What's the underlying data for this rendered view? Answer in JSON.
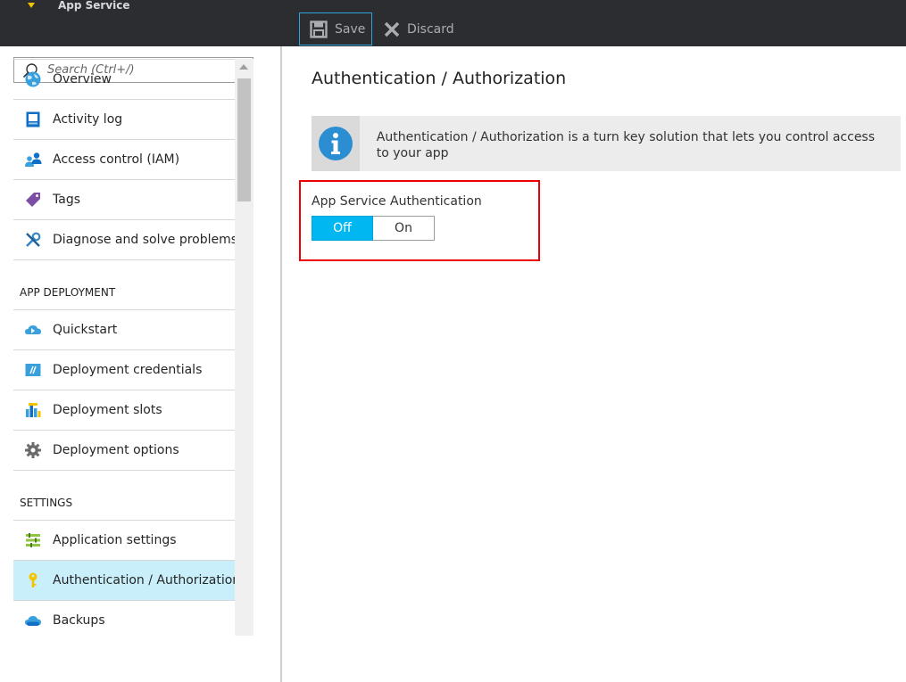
{
  "header": {
    "app_title": "App Service",
    "save_label": "Save",
    "discard_label": "Discard"
  },
  "search": {
    "placeholder": "Search (Ctrl+/)"
  },
  "sidebar": {
    "items": [
      {
        "label": "Overview",
        "icon": "globe-icon"
      },
      {
        "label": "Activity log",
        "icon": "activity-log-icon"
      },
      {
        "label": "Access control (IAM)",
        "icon": "people-icon"
      },
      {
        "label": "Tags",
        "icon": "tag-icon"
      },
      {
        "label": "Diagnose and solve problems",
        "icon": "wrench-icon"
      }
    ],
    "sections": [
      {
        "title": "APP DEPLOYMENT",
        "items": [
          {
            "label": "Quickstart",
            "icon": "cloud-icon"
          },
          {
            "label": "Deployment credentials",
            "icon": "credentials-icon"
          },
          {
            "label": "Deployment slots",
            "icon": "slots-icon"
          },
          {
            "label": "Deployment options",
            "icon": "gear-icon"
          }
        ]
      },
      {
        "title": "SETTINGS",
        "items": [
          {
            "label": "Application settings",
            "icon": "settings-list-icon"
          },
          {
            "label": "Authentication / Authorization",
            "icon": "key-icon",
            "active": true
          },
          {
            "label": "Backups",
            "icon": "backup-cloud-icon"
          }
        ]
      }
    ]
  },
  "main": {
    "title": "Authentication / Authorization",
    "info_text": "Authentication / Authorization is a turn key solution that lets you control access to your app",
    "auth_label": "App Service Authentication",
    "toggle": {
      "off_label": "Off",
      "on_label": "On",
      "selected": "Off"
    }
  },
  "colors": {
    "header_bg": "#2b2d31",
    "accent": "#00b7f2",
    "active_item_bg": "#c9effb",
    "highlight_border": "#e00000",
    "key_yellow": "#f5c400"
  }
}
